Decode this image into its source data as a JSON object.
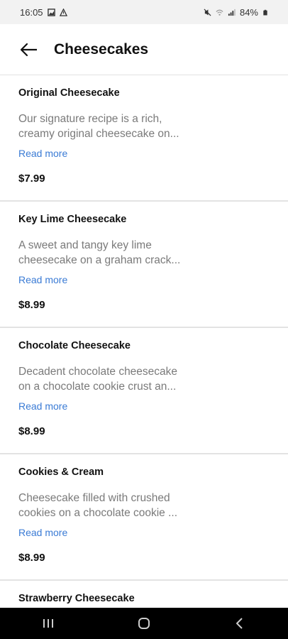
{
  "status": {
    "time": "16:05",
    "battery": "84%"
  },
  "header": {
    "title": "Cheesecakes"
  },
  "items": [
    {
      "name": "Original Cheesecake",
      "desc_line1": "Our signature recipe is a rich,",
      "desc_line2": "creamy original cheesecake on...",
      "read_more": "Read more",
      "price": "$7.99"
    },
    {
      "name": "Key Lime Cheesecake",
      "desc_line1": "A sweet and tangy key lime",
      "desc_line2": "cheesecake on a graham crack...",
      "read_more": "Read more",
      "price": "$8.99"
    },
    {
      "name": "Chocolate Cheesecake",
      "desc_line1": "Decadent chocolate cheesecake",
      "desc_line2": "on a chocolate cookie crust an...",
      "read_more": "Read more",
      "price": "$8.99"
    },
    {
      "name": "Cookies & Cream",
      "desc_line1": "Cheesecake filled with crushed",
      "desc_line2": "cookies on a chocolate cookie ...",
      "read_more": "Read more",
      "price": "$8.99"
    },
    {
      "name": "Strawberry Cheesecake"
    }
  ],
  "icons": {
    "back": "arrow-left-icon",
    "nav_recents": "recents-icon",
    "nav_home": "home-icon",
    "nav_back": "chevron-left-icon"
  },
  "colors": {
    "link": "#3a7bd5",
    "muted_text": "#7a7a7a"
  }
}
